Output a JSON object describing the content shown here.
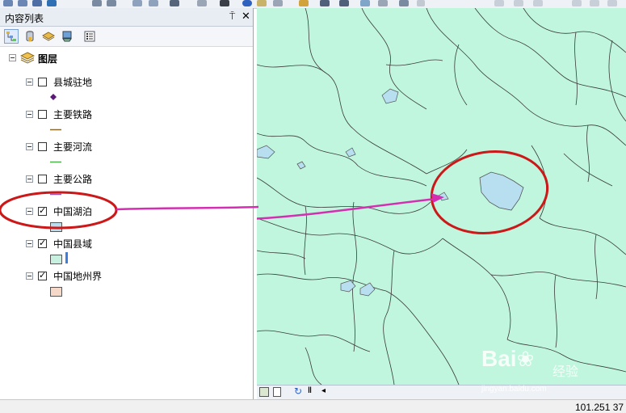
{
  "window": {
    "panel_title": "内容列表"
  },
  "toc": {
    "root": {
      "label": "图层"
    },
    "layers": [
      {
        "name": "县城驻地",
        "checked": false
      },
      {
        "name": "主要铁路",
        "checked": false
      },
      {
        "name": "主要河流",
        "checked": false
      },
      {
        "name": "主要公路",
        "checked": false
      },
      {
        "name": "中国湖泊",
        "checked": true
      },
      {
        "name": "中国县域",
        "checked": true
      },
      {
        "name": "中国地州界",
        "checked": true
      }
    ]
  },
  "status": {
    "coordinates": "101.251  37"
  },
  "watermark": {
    "logo": "Bai经验",
    "text": "经验",
    "url": "jingyan.baidu.com"
  },
  "colors": {
    "map_fill": "#bff6dd",
    "lake_fill": "#b7dff0",
    "highlight": "#cc1818",
    "arrow": "#d42fb2",
    "county_symbol": "#c8f0e0",
    "prefecture_symbol": "#f6d8c8"
  },
  "icons": [
    "list-by-drawing-order-icon",
    "list-by-source-icon",
    "list-by-visibility-icon",
    "list-by-selection-icon",
    "options-icon",
    "pin-icon",
    "close-icon",
    "layers-group-icon"
  ]
}
